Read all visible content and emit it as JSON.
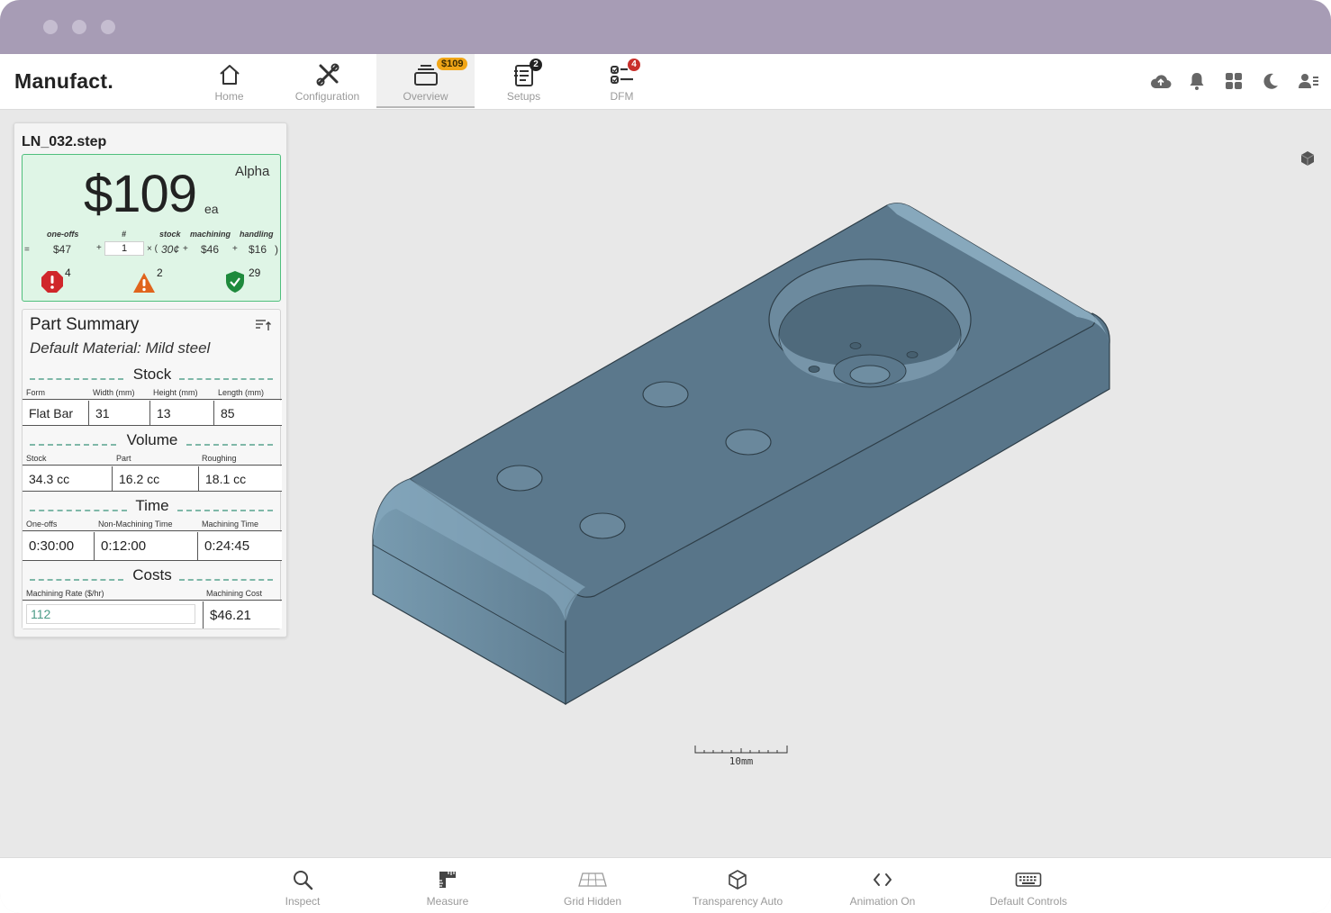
{
  "app": {
    "brand": "Manufact."
  },
  "nav": {
    "tabs": [
      {
        "label": "Home",
        "icon": "home-icon"
      },
      {
        "label": "Configuration",
        "icon": "tools-icon"
      },
      {
        "label": "Overview",
        "icon": "stack-icon",
        "badge": "$109",
        "active": true
      },
      {
        "label": "Setups",
        "icon": "setups-icon",
        "badge": "2"
      },
      {
        "label": "DFM",
        "icon": "checklist-icon",
        "badge": "4"
      }
    ],
    "right_icons": [
      "cloud-upload-icon",
      "bell-icon",
      "grid-icon",
      "moon-icon",
      "user-icon"
    ]
  },
  "part": {
    "filename": "LN_032.step",
    "price": "$109",
    "unit": "ea",
    "tier": "Alpha",
    "formula": {
      "headers": {
        "oneoffs": "one-offs",
        "qty": "#",
        "stock": "stock",
        "machining": "machining",
        "handling": "handling"
      },
      "eq": "=",
      "oneoffs": "$47",
      "plus1": "+",
      "qty": "1",
      "times": "× (",
      "stock": "30¢",
      "plus2": "+",
      "machining": "$46",
      "plus3": "+",
      "handling": "$16",
      "close": ")"
    },
    "status": {
      "errors": "4",
      "warnings": "2",
      "passed": "29"
    }
  },
  "summary": {
    "title": "Part Summary",
    "material": "Default Material: Mild steel",
    "stock": {
      "title": "Stock",
      "headers": [
        "Form",
        "Width (mm)",
        "Height (mm)",
        "Length (mm)"
      ],
      "values": [
        "Flat Bar",
        "31",
        "13",
        "85"
      ]
    },
    "volume": {
      "title": "Volume",
      "headers": [
        "Stock",
        "Part",
        "Roughing"
      ],
      "values": [
        "34.3 cc",
        "16.2 cc",
        "18.1 cc"
      ]
    },
    "time": {
      "title": "Time",
      "headers": [
        "One-offs",
        "Non-Machining Time",
        "Machining Time"
      ],
      "values": [
        "0:30:00",
        "0:12:00",
        "0:24:45"
      ]
    },
    "costs": {
      "title": "Costs",
      "rate_label": "Machining Rate ($/hr)",
      "cost_label": "Machining Cost",
      "rate_value": "112",
      "cost_value": "$46.21"
    }
  },
  "viewport": {
    "scale_label": "10mm",
    "model_color": "#5d7a8e"
  },
  "toolbar": {
    "tools": [
      {
        "label": "Inspect",
        "icon": "magnifier-icon"
      },
      {
        "label": "Measure",
        "icon": "ruler-icon"
      },
      {
        "label": "Grid Hidden",
        "icon": "grid-plane-icon"
      },
      {
        "label": "Transparency Auto",
        "icon": "cube-outline-icon"
      },
      {
        "label": "Animation On",
        "icon": "code-brackets-icon"
      },
      {
        "label": "Default Controls",
        "icon": "keyboard-icon"
      }
    ]
  }
}
